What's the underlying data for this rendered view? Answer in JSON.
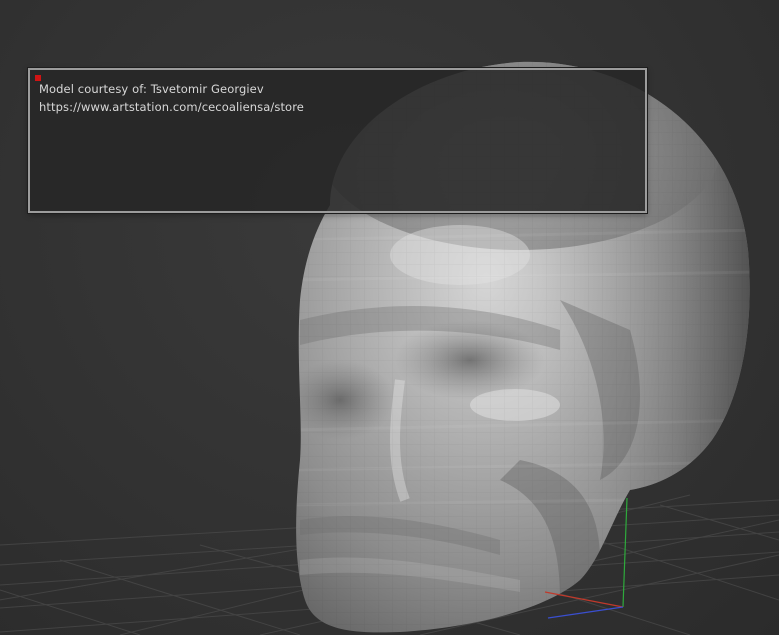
{
  "overlay": {
    "credit_text": "Model courtesy of: Tsvetomir Georgiev",
    "credit_url": "https://www.artstation.com/cecoaliensa/store"
  },
  "scene": {
    "model_icon": "sculpted-head-mesh",
    "background_color": "#333333",
    "model_color": "#a9a9a9",
    "axis_colors": {
      "x": "#c0392b",
      "y": "#2eaa3c",
      "z": "#3a4fd0"
    }
  }
}
